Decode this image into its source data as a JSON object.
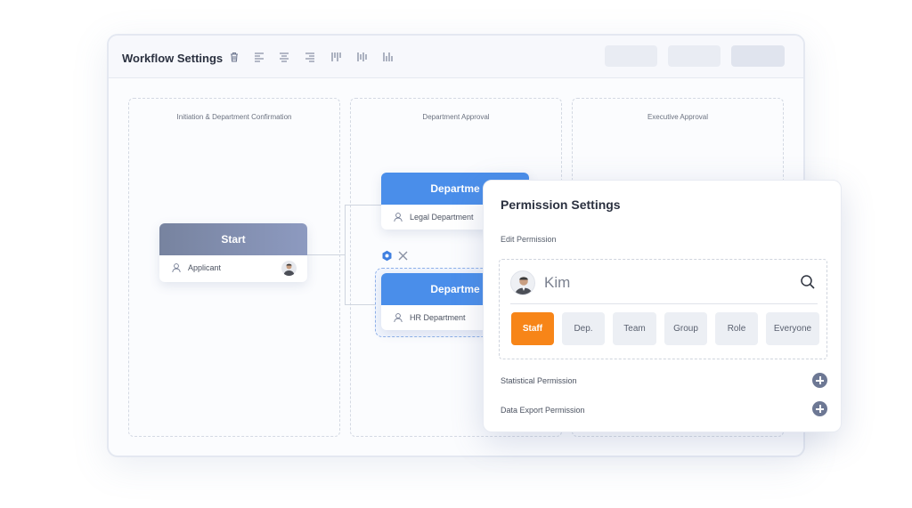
{
  "window": {
    "title": "Workflow Settings",
    "toolbar_icons": [
      "trash-icon",
      "align-left-icon",
      "align-center-icon",
      "align-right-icon",
      "align-top-icon",
      "align-middle-icon",
      "align-bottom-icon"
    ]
  },
  "lanes": [
    {
      "title": "Initiation & Department Confirmation"
    },
    {
      "title": "Department Approval"
    },
    {
      "title": "Executive Approval"
    }
  ],
  "nodes": {
    "start": {
      "title": "Start",
      "assignee": "Applicant"
    },
    "legal": {
      "title": "Departme",
      "assignee": "Legal Department"
    },
    "hr": {
      "title": "Departme",
      "assignee": "HR Department"
    }
  },
  "panel": {
    "title": "Permission Settings",
    "edit_label": "Edit Permission",
    "search_value": "Kim",
    "chips": [
      "Staff",
      "Dep.",
      "Team",
      "Group",
      "Role",
      "Everyone"
    ],
    "active_chip": "Staff",
    "rows": [
      "Statistical Permission",
      "Data Export Permission"
    ]
  },
  "colors": {
    "start_head": "#7d8aac",
    "dept_head": "#4a8eea",
    "accent_orange": "#f78518",
    "gear_blue": "#3f7fe0"
  }
}
